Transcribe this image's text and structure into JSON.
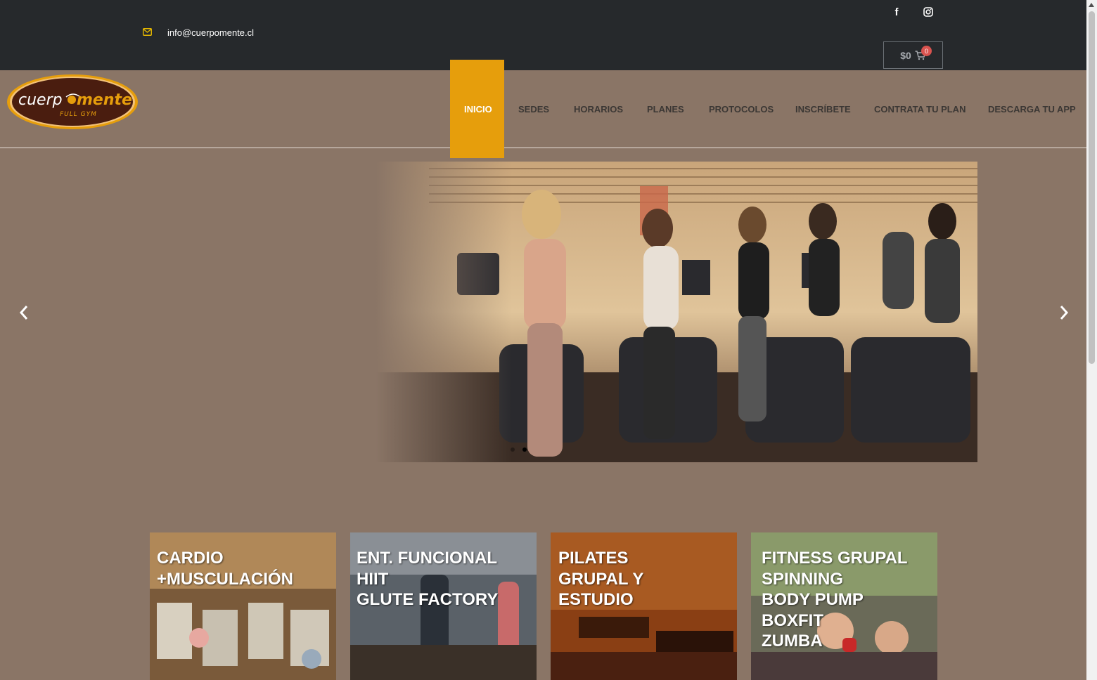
{
  "topbar": {
    "email": "info@cuerpomente.cl",
    "cart_total": "$0",
    "cart_count": "0"
  },
  "logo": {
    "wordmark_a": "cuerp",
    "wordmark_b": "mente",
    "tagline": "FULL GYM"
  },
  "nav": {
    "items": [
      {
        "label": "INICIO",
        "active": true
      },
      {
        "label": "SEDES"
      },
      {
        "label": "HORARIOS"
      },
      {
        "label": "PLANES"
      },
      {
        "label": "PROTOCOLOS"
      },
      {
        "label": "INSCRÍBETE"
      },
      {
        "label": "CONTRATA TU PLAN"
      },
      {
        "label": "DESCARGA TU APP"
      }
    ]
  },
  "slider": {
    "prev_icon": "chevron-left-icon",
    "next_icon": "chevron-right-icon",
    "dots": 2,
    "active_dot": 1
  },
  "cards": [
    {
      "title": "CARDIO\n+MUSCULACIÓN"
    },
    {
      "title": "ENT. FUNCIONAL\nHIIT\nGLUTE FACTORY"
    },
    {
      "title": "PILATES\nGRUPAL Y\nESTUDIO"
    },
    {
      "title": "FITNESS GRUPAL\nSPINNING\nBODY PUMP\nBOXFIT\nZUMBA"
    }
  ],
  "colors": {
    "topbar": "#26292c",
    "page_bg": "#8a7566",
    "accent": "#e69e0c"
  }
}
